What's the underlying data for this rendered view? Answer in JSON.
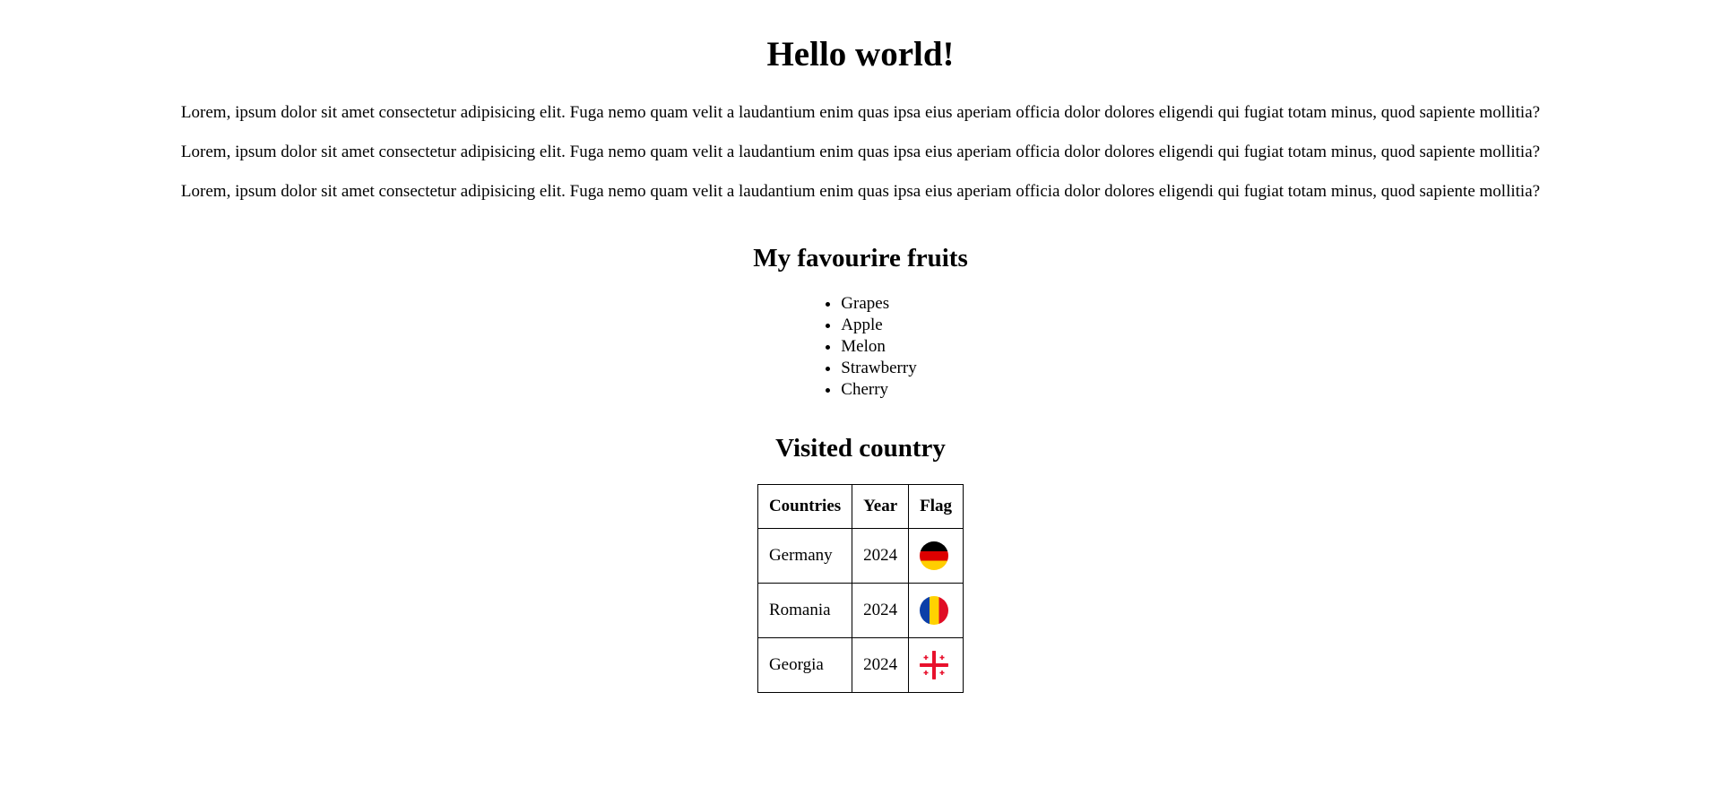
{
  "heading": "Hello world!",
  "paragraphs": [
    "Lorem, ipsum dolor sit amet consectetur adipisicing elit. Fuga nemo quam velit a laudantium enim quas ipsa eius aperiam officia dolor dolores eligendi qui fugiat totam minus, quod sapiente mollitia?",
    "Lorem, ipsum dolor sit amet consectetur adipisicing elit. Fuga nemo quam velit a laudantium enim quas ipsa eius aperiam officia dolor dolores eligendi qui fugiat totam minus, quod sapiente mollitia?",
    "Lorem, ipsum dolor sit amet consectetur adipisicing elit. Fuga nemo quam velit a laudantium enim quas ipsa eius aperiam officia dolor dolores eligendi qui fugiat totam minus, quod sapiente mollitia?"
  ],
  "fruits": {
    "title": "My favourire fruits",
    "items": [
      "Grapes",
      "Apple",
      "Melon",
      "Strawberry",
      "Cherry"
    ]
  },
  "countries": {
    "title": "Visited country",
    "columns": [
      "Countries",
      "Year",
      "Flag"
    ],
    "rows": [
      {
        "country": "Germany",
        "year": "2024",
        "flag_icon": "germany-flag-icon",
        "flag_colors": [
          "#000000",
          "#dd0000",
          "#ffce00"
        ]
      },
      {
        "country": "Romania",
        "year": "2024",
        "flag_icon": "romania-flag-icon",
        "flag_colors": [
          "#0b3fa8",
          "#ffd200",
          "#e00d25"
        ]
      },
      {
        "country": "Georgia",
        "year": "2024",
        "flag_icon": "georgia-flag-icon",
        "flag_colors": [
          "#ffffff",
          "#e8112d"
        ]
      }
    ]
  }
}
